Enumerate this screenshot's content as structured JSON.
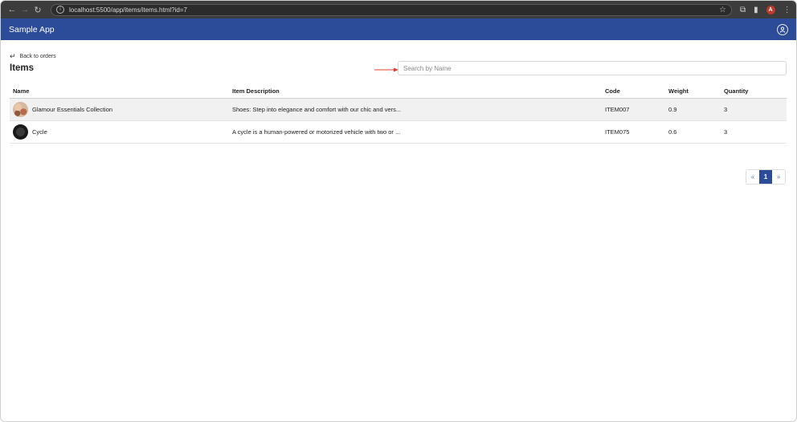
{
  "browser": {
    "url": "localhost:5500/app/items/items.html?id=7",
    "profile_initial": "A",
    "icons": [
      "back-arrow-icon",
      "forward-arrow-icon",
      "reload-icon",
      "info-icon",
      "star-icon",
      "extensions-icon",
      "sidebar-icon",
      "menu-icon"
    ]
  },
  "header": {
    "app_title": "Sample App",
    "user_icon": "user-icon"
  },
  "page": {
    "back_label": "Back to orders",
    "title": "Items",
    "search_placeholder": "Search by Name",
    "search_value": ""
  },
  "table": {
    "columns": {
      "name": "Name",
      "description": "Item Description",
      "code": "Code",
      "weight": "Weight",
      "quantity": "Quantity"
    },
    "rows": [
      {
        "name": "Glamour Essentials Collection",
        "description": "Shoes: Step into elegance and comfort with our chic and vers...",
        "code": "ITEM007",
        "weight": "0.9",
        "quantity": "3"
      },
      {
        "name": "Cycle",
        "description": "A cycle is a human-powered or motorized vehicle with two or ...",
        "code": "ITEM075",
        "weight": "0.6",
        "quantity": "3"
      }
    ]
  },
  "pagination": {
    "prev": "«",
    "current": "1",
    "next": "»"
  },
  "colors": {
    "header": "#2c4c9a",
    "annotation_arrow": "#e03c2e"
  }
}
